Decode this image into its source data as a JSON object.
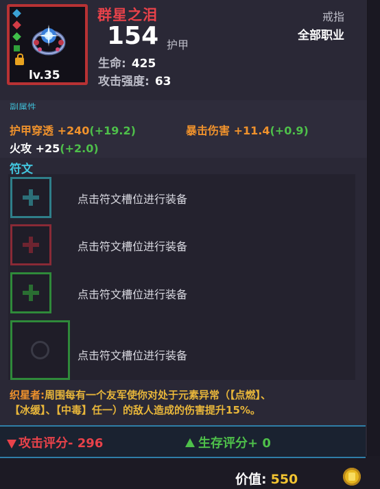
{
  "item": {
    "name": "群星之泪",
    "level": "lv.35",
    "armor_value": "154",
    "armor_label": "护甲",
    "slot_type": "戒指",
    "class_requirement": "全部职业",
    "stats": [
      {
        "label": "生命:",
        "value": "425"
      },
      {
        "label": "攻击强度:",
        "value": "63"
      }
    ]
  },
  "sub_attributes": {
    "title": "副属性",
    "entries": [
      {
        "name": "护甲穿透",
        "value": "+240",
        "bonus": "(+19.2)"
      },
      {
        "name": "暴击伤害",
        "value": "+11.4",
        "bonus": "(+0.9)"
      },
      {
        "name": "火攻",
        "value": "+25",
        "bonus": "(+2.0)"
      }
    ]
  },
  "runes": {
    "title": "符文",
    "slots": [
      {
        "label": "点击符文槽位进行装备",
        "color": "#2f7f8a"
      },
      {
        "label": "点击符文槽位进行装备",
        "color": "#8a2a36"
      },
      {
        "label": "点击符文槽位进行装备",
        "color": "#2f8a3a"
      },
      {
        "label": "点击符文槽位进行装备",
        "color": "#2f8a3a"
      }
    ]
  },
  "effect": {
    "name": "织星者:",
    "text_line1": "周围每有一个友军使你对处于元素异常（【点燃】、",
    "text_line2": "【冰缓】、【中毒】任一）的敌人造成的伤害提升15%。"
  },
  "scores": {
    "attack_label": "攻击评分-",
    "attack_value": "296",
    "survival_label": "生存评分+",
    "survival_value": "0"
  },
  "price": {
    "label": "价值:",
    "value": "550"
  },
  "colors": {
    "accent_red": "#e8424a",
    "accent_orange": "#f0922c",
    "accent_green": "#4ec04a",
    "accent_cyan": "#42c6de",
    "gold": "#f2c431"
  }
}
